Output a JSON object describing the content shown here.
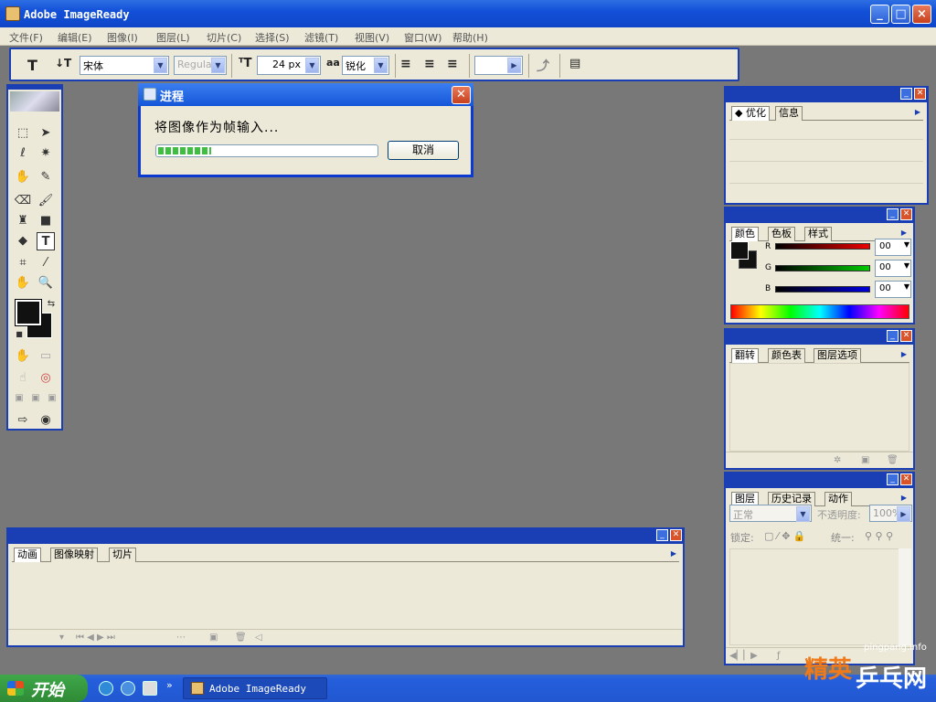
{
  "window": {
    "title": "Adobe ImageReady"
  },
  "menu": [
    "文件(F)",
    "编辑(E)",
    "图像(I)",
    "图层(L)",
    "切片(C)",
    "选择(S)",
    "滤镜(T)",
    "视图(V)",
    "窗口(W)",
    "帮助(H)"
  ],
  "options": {
    "font_family": "宋体",
    "font_style": "Regular",
    "font_size": "24 px",
    "aa_icon_text": "aa",
    "antialias": "锐化",
    "tool_icon": "T"
  },
  "dialog": {
    "title": "进程",
    "message": "将图像作为帧输入...",
    "cancel": "取消",
    "progress": 0.24
  },
  "optimize_panel": {
    "tabs": [
      "优化",
      "信息"
    ]
  },
  "color_panel": {
    "tabs": [
      "颜色",
      "色板",
      "样式"
    ],
    "r_label": "R",
    "g_label": "G",
    "b_label": "B",
    "r": "00",
    "g": "00",
    "b": "00"
  },
  "flip_panel": {
    "tabs": [
      "翻转",
      "颜色表",
      "图层选项"
    ]
  },
  "layers_panel": {
    "tabs": [
      "图层",
      "历史记录",
      "动作"
    ],
    "blend": "正常",
    "opacity_label": "不透明度:",
    "opacity": "100%",
    "lock_label": "锁定:",
    "unify_label": "统一:"
  },
  "animation_panel": {
    "tabs": [
      "动画",
      "图像映射",
      "切片"
    ]
  },
  "taskbar": {
    "start": "开始",
    "app": "Adobe ImageReady"
  },
  "watermark": {
    "site": "pingpang.info",
    "cn1": "精英",
    "cn2": "乒乓网"
  },
  "colors": {
    "titlebar": "#1350d8",
    "panel_bg": "#ece9d8",
    "workspace": "#787878",
    "panel_border": "#1a3fb4"
  }
}
